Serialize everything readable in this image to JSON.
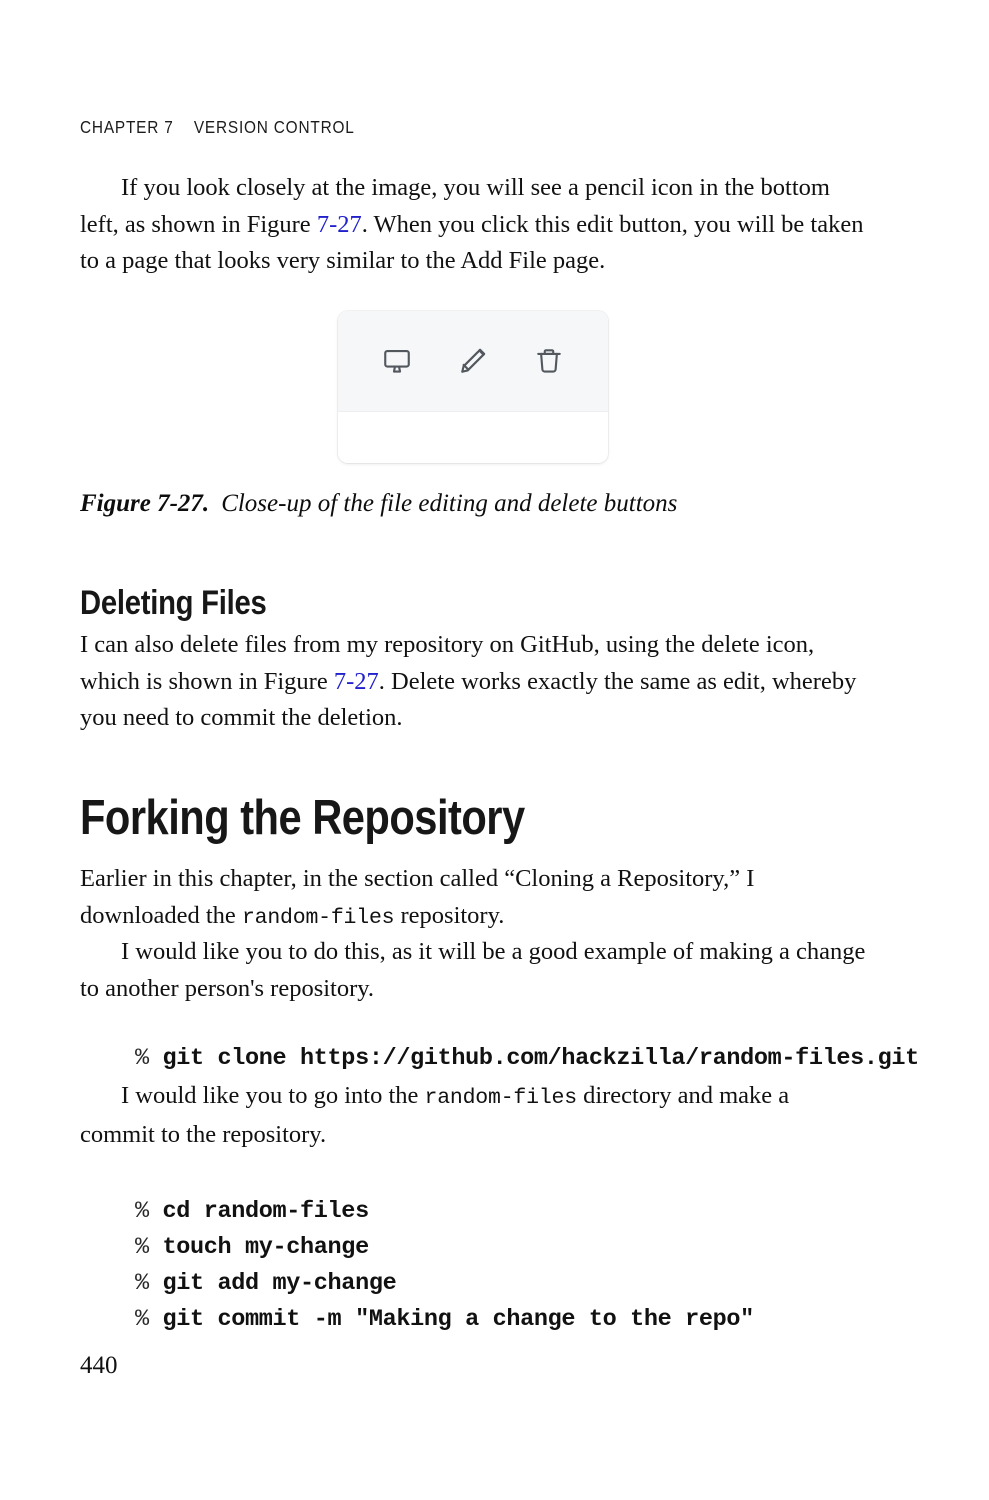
{
  "running_head": {
    "chapter": "CHAPTER 7",
    "title": "VERSION CONTROL",
    "full": "CHAPTER 7    VERSION CONTROL"
  },
  "paragraphs": {
    "p1_a": "If you look closely at the image, you will see a pencil icon in the bottom left, as shown in Figure ",
    "p1_link": "7-27",
    "p1_b": ". When you click this edit button, you will be taken to a page that looks very similar to the Add File page.",
    "p2_a": "I can also delete files from my repository on GitHub, using the delete icon, which is shown in Figure ",
    "p2_link": "7-27",
    "p2_b": ". Delete works exactly the same as edit, whereby you need to commit the deletion.",
    "p3_a": "Earlier in this chapter, in the section called “Cloning a Repository,” I downloaded the ",
    "p3_code": "random-files",
    "p3_b": " repository.",
    "p4": "I would like you to do this, as it will be a good example of making a change to another person's repository.",
    "p5_a": "I would like you to go into the ",
    "p5_code": "random-files",
    "p5_b": " directory and make a commit to the repository."
  },
  "figure": {
    "caption_label": "Figure 7-27.",
    "caption_text": "Close-up of the file editing and delete buttons",
    "panel": {
      "background": "#f6f7f9",
      "body_background": "#ffffff",
      "icon_color": "#53585f",
      "buttons": [
        {
          "name": "monitor-icon",
          "label": "Preview"
        },
        {
          "name": "pencil-icon",
          "label": "Edit"
        },
        {
          "name": "trash-icon",
          "label": "Delete"
        }
      ]
    }
  },
  "headings": {
    "deleting_files": "Deleting Files",
    "forking_the_repository": "Forking the Repository"
  },
  "code_blocks": {
    "clone": [
      {
        "prompt": "% ",
        "command": "git clone https://github.com/hackzilla/random-files.git"
      }
    ],
    "commit_sequence": [
      {
        "prompt": "% ",
        "command": "cd random-files"
      },
      {
        "prompt": "% ",
        "command": "touch my-change"
      },
      {
        "prompt": "% ",
        "command": "git add my-change"
      },
      {
        "prompt": "% ",
        "command": "git commit -m \"Making a change to the repo\""
      }
    ]
  },
  "folio": "440",
  "colors": {
    "link": "#2020cc",
    "text": "#111111",
    "heading": "#171717",
    "panel_gray": "#f6f7f9"
  }
}
